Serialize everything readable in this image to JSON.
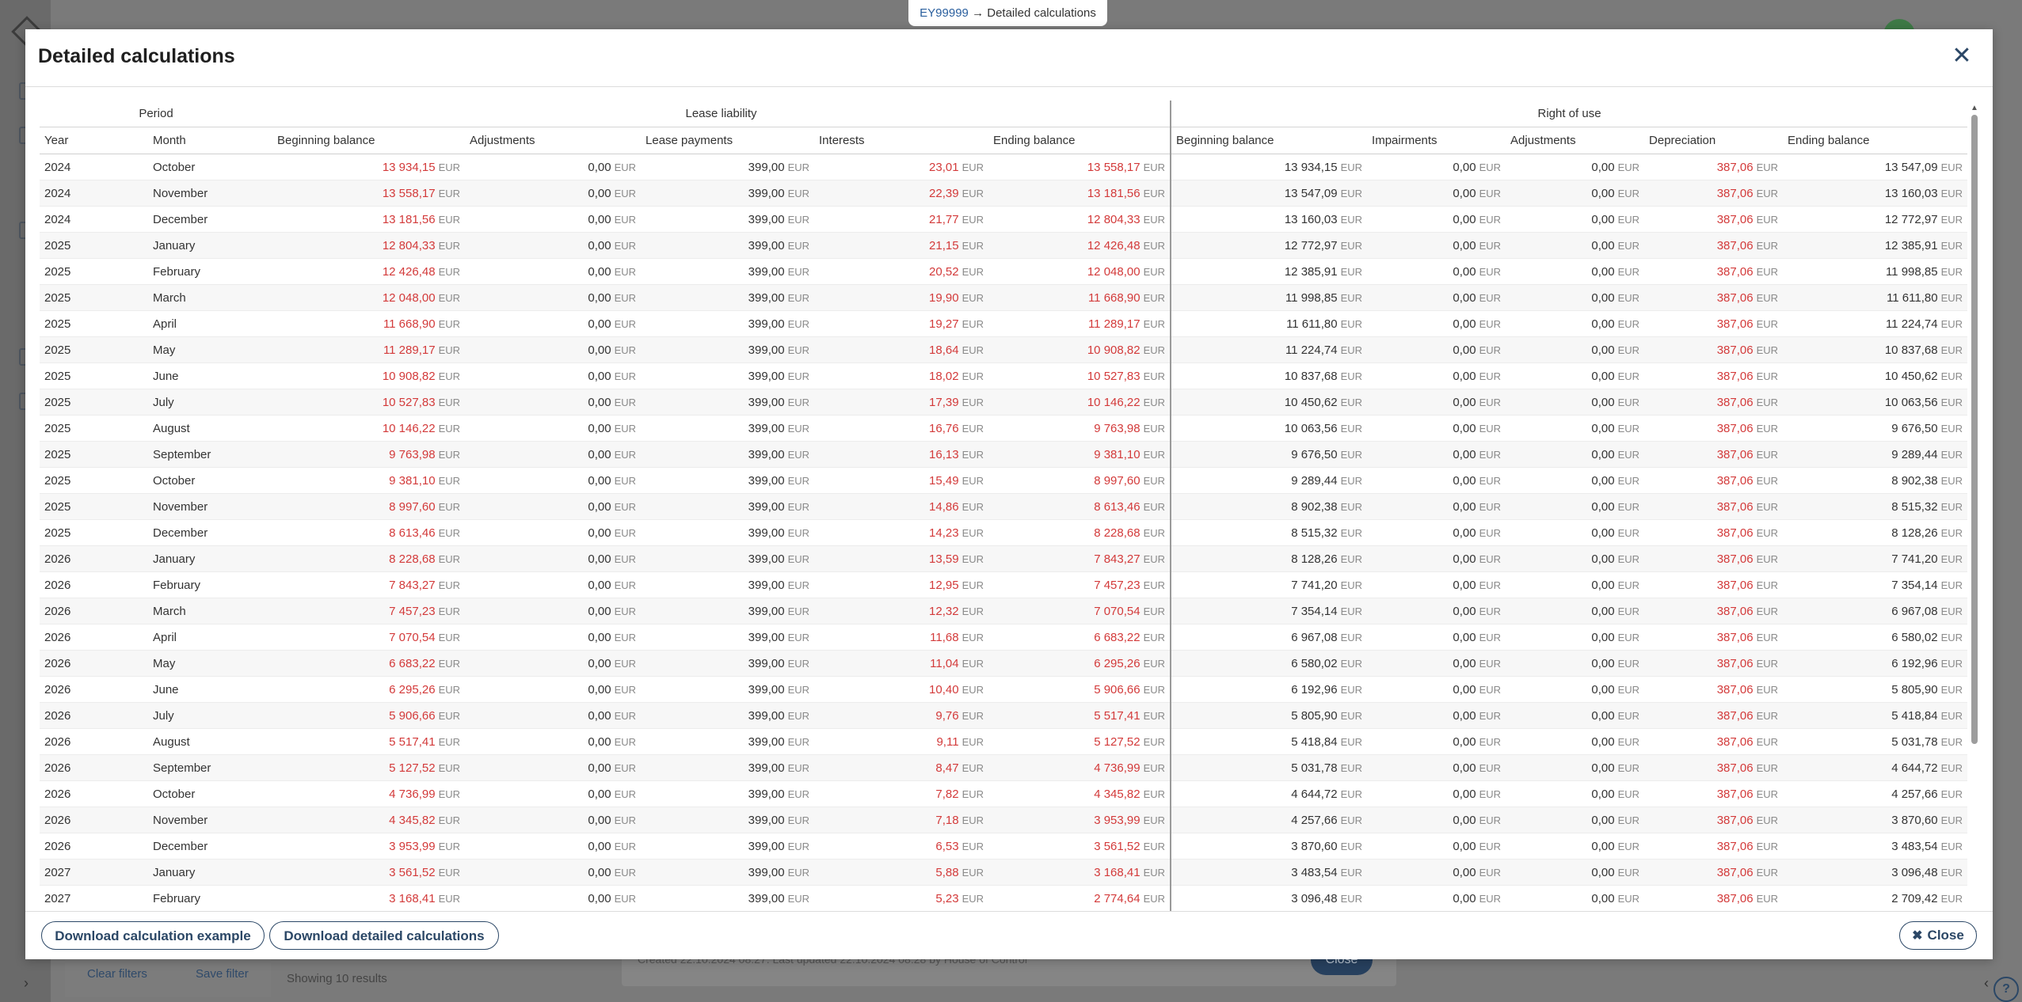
{
  "breadcrumb": {
    "link": "EY99999",
    "separator": "→",
    "current": "Detailed calculations"
  },
  "background": {
    "clear_filters": "Clear filters",
    "save_filter": "Save filter",
    "showing": "Showing 10 results",
    "card_text": "Created 22.10.2024 08:27. Last updated 22.10.2024 08:28 by House of Control",
    "card_close": "Close"
  },
  "modal": {
    "title": "Detailed calculations",
    "close_icon": "close-icon",
    "groups": {
      "period": "Period",
      "lease_liability": "Lease liability",
      "right_of_use": "Right of use"
    },
    "columns": {
      "year": "Year",
      "month": "Month",
      "ll_beginning": "Beginning balance",
      "ll_adjustments": "Adjustments",
      "ll_payments": "Lease payments",
      "ll_interests": "Interests",
      "ll_ending": "Ending balance",
      "ru_beginning": "Beginning balance",
      "ru_impairments": "Impairments",
      "ru_adjustments": "Adjustments",
      "ru_depreciation": "Depreciation",
      "ru_ending": "Ending balance"
    },
    "currency": "EUR",
    "rows": [
      {
        "year": "2024",
        "month": "October",
        "ll_begin": "13 934,15",
        "ll_adj": "0,00",
        "ll_pay": "399,00",
        "ll_int": "23,01",
        "ll_end": "13 558,17",
        "ru_begin": "13 934,15",
        "ru_imp": "0,00",
        "ru_adj": "0,00",
        "ru_dep": "387,06",
        "ru_end": "13 547,09"
      },
      {
        "year": "2024",
        "month": "November",
        "ll_begin": "13 558,17",
        "ll_adj": "0,00",
        "ll_pay": "399,00",
        "ll_int": "22,39",
        "ll_end": "13 181,56",
        "ru_begin": "13 547,09",
        "ru_imp": "0,00",
        "ru_adj": "0,00",
        "ru_dep": "387,06",
        "ru_end": "13 160,03"
      },
      {
        "year": "2024",
        "month": "December",
        "ll_begin": "13 181,56",
        "ll_adj": "0,00",
        "ll_pay": "399,00",
        "ll_int": "21,77",
        "ll_end": "12 804,33",
        "ru_begin": "13 160,03",
        "ru_imp": "0,00",
        "ru_adj": "0,00",
        "ru_dep": "387,06",
        "ru_end": "12 772,97"
      },
      {
        "year": "2025",
        "month": "January",
        "ll_begin": "12 804,33",
        "ll_adj": "0,00",
        "ll_pay": "399,00",
        "ll_int": "21,15",
        "ll_end": "12 426,48",
        "ru_begin": "12 772,97",
        "ru_imp": "0,00",
        "ru_adj": "0,00",
        "ru_dep": "387,06",
        "ru_end": "12 385,91"
      },
      {
        "year": "2025",
        "month": "February",
        "ll_begin": "12 426,48",
        "ll_adj": "0,00",
        "ll_pay": "399,00",
        "ll_int": "20,52",
        "ll_end": "12 048,00",
        "ru_begin": "12 385,91",
        "ru_imp": "0,00",
        "ru_adj": "0,00",
        "ru_dep": "387,06",
        "ru_end": "11 998,85"
      },
      {
        "year": "2025",
        "month": "March",
        "ll_begin": "12 048,00",
        "ll_adj": "0,00",
        "ll_pay": "399,00",
        "ll_int": "19,90",
        "ll_end": "11 668,90",
        "ru_begin": "11 998,85",
        "ru_imp": "0,00",
        "ru_adj": "0,00",
        "ru_dep": "387,06",
        "ru_end": "11 611,80"
      },
      {
        "year": "2025",
        "month": "April",
        "ll_begin": "11 668,90",
        "ll_adj": "0,00",
        "ll_pay": "399,00",
        "ll_int": "19,27",
        "ll_end": "11 289,17",
        "ru_begin": "11 611,80",
        "ru_imp": "0,00",
        "ru_adj": "0,00",
        "ru_dep": "387,06",
        "ru_end": "11 224,74"
      },
      {
        "year": "2025",
        "month": "May",
        "ll_begin": "11 289,17",
        "ll_adj": "0,00",
        "ll_pay": "399,00",
        "ll_int": "18,64",
        "ll_end": "10 908,82",
        "ru_begin": "11 224,74",
        "ru_imp": "0,00",
        "ru_adj": "0,00",
        "ru_dep": "387,06",
        "ru_end": "10 837,68"
      },
      {
        "year": "2025",
        "month": "June",
        "ll_begin": "10 908,82",
        "ll_adj": "0,00",
        "ll_pay": "399,00",
        "ll_int": "18,02",
        "ll_end": "10 527,83",
        "ru_begin": "10 837,68",
        "ru_imp": "0,00",
        "ru_adj": "0,00",
        "ru_dep": "387,06",
        "ru_end": "10 450,62"
      },
      {
        "year": "2025",
        "month": "July",
        "ll_begin": "10 527,83",
        "ll_adj": "0,00",
        "ll_pay": "399,00",
        "ll_int": "17,39",
        "ll_end": "10 146,22",
        "ru_begin": "10 450,62",
        "ru_imp": "0,00",
        "ru_adj": "0,00",
        "ru_dep": "387,06",
        "ru_end": "10 063,56"
      },
      {
        "year": "2025",
        "month": "August",
        "ll_begin": "10 146,22",
        "ll_adj": "0,00",
        "ll_pay": "399,00",
        "ll_int": "16,76",
        "ll_end": "9 763,98",
        "ru_begin": "10 063,56",
        "ru_imp": "0,00",
        "ru_adj": "0,00",
        "ru_dep": "387,06",
        "ru_end": "9 676,50"
      },
      {
        "year": "2025",
        "month": "September",
        "ll_begin": "9 763,98",
        "ll_adj": "0,00",
        "ll_pay": "399,00",
        "ll_int": "16,13",
        "ll_end": "9 381,10",
        "ru_begin": "9 676,50",
        "ru_imp": "0,00",
        "ru_adj": "0,00",
        "ru_dep": "387,06",
        "ru_end": "9 289,44"
      },
      {
        "year": "2025",
        "month": "October",
        "ll_begin": "9 381,10",
        "ll_adj": "0,00",
        "ll_pay": "399,00",
        "ll_int": "15,49",
        "ll_end": "8 997,60",
        "ru_begin": "9 289,44",
        "ru_imp": "0,00",
        "ru_adj": "0,00",
        "ru_dep": "387,06",
        "ru_end": "8 902,38"
      },
      {
        "year": "2025",
        "month": "November",
        "ll_begin": "8 997,60",
        "ll_adj": "0,00",
        "ll_pay": "399,00",
        "ll_int": "14,86",
        "ll_end": "8 613,46",
        "ru_begin": "8 902,38",
        "ru_imp": "0,00",
        "ru_adj": "0,00",
        "ru_dep": "387,06",
        "ru_end": "8 515,32"
      },
      {
        "year": "2025",
        "month": "December",
        "ll_begin": "8 613,46",
        "ll_adj": "0,00",
        "ll_pay": "399,00",
        "ll_int": "14,23",
        "ll_end": "8 228,68",
        "ru_begin": "8 515,32",
        "ru_imp": "0,00",
        "ru_adj": "0,00",
        "ru_dep": "387,06",
        "ru_end": "8 128,26"
      },
      {
        "year": "2026",
        "month": "January",
        "ll_begin": "8 228,68",
        "ll_adj": "0,00",
        "ll_pay": "399,00",
        "ll_int": "13,59",
        "ll_end": "7 843,27",
        "ru_begin": "8 128,26",
        "ru_imp": "0,00",
        "ru_adj": "0,00",
        "ru_dep": "387,06",
        "ru_end": "7 741,20"
      },
      {
        "year": "2026",
        "month": "February",
        "ll_begin": "7 843,27",
        "ll_adj": "0,00",
        "ll_pay": "399,00",
        "ll_int": "12,95",
        "ll_end": "7 457,23",
        "ru_begin": "7 741,20",
        "ru_imp": "0,00",
        "ru_adj": "0,00",
        "ru_dep": "387,06",
        "ru_end": "7 354,14"
      },
      {
        "year": "2026",
        "month": "March",
        "ll_begin": "7 457,23",
        "ll_adj": "0,00",
        "ll_pay": "399,00",
        "ll_int": "12,32",
        "ll_end": "7 070,54",
        "ru_begin": "7 354,14",
        "ru_imp": "0,00",
        "ru_adj": "0,00",
        "ru_dep": "387,06",
        "ru_end": "6 967,08"
      },
      {
        "year": "2026",
        "month": "April",
        "ll_begin": "7 070,54",
        "ll_adj": "0,00",
        "ll_pay": "399,00",
        "ll_int": "11,68",
        "ll_end": "6 683,22",
        "ru_begin": "6 967,08",
        "ru_imp": "0,00",
        "ru_adj": "0,00",
        "ru_dep": "387,06",
        "ru_end": "6 580,02"
      },
      {
        "year": "2026",
        "month": "May",
        "ll_begin": "6 683,22",
        "ll_adj": "0,00",
        "ll_pay": "399,00",
        "ll_int": "11,04",
        "ll_end": "6 295,26",
        "ru_begin": "6 580,02",
        "ru_imp": "0,00",
        "ru_adj": "0,00",
        "ru_dep": "387,06",
        "ru_end": "6 192,96"
      },
      {
        "year": "2026",
        "month": "June",
        "ll_begin": "6 295,26",
        "ll_adj": "0,00",
        "ll_pay": "399,00",
        "ll_int": "10,40",
        "ll_end": "5 906,66",
        "ru_begin": "6 192,96",
        "ru_imp": "0,00",
        "ru_adj": "0,00",
        "ru_dep": "387,06",
        "ru_end": "5 805,90"
      },
      {
        "year": "2026",
        "month": "July",
        "ll_begin": "5 906,66",
        "ll_adj": "0,00",
        "ll_pay": "399,00",
        "ll_int": "9,76",
        "ll_end": "5 517,41",
        "ru_begin": "5 805,90",
        "ru_imp": "0,00",
        "ru_adj": "0,00",
        "ru_dep": "387,06",
        "ru_end": "5 418,84"
      },
      {
        "year": "2026",
        "month": "August",
        "ll_begin": "5 517,41",
        "ll_adj": "0,00",
        "ll_pay": "399,00",
        "ll_int": "9,11",
        "ll_end": "5 127,52",
        "ru_begin": "5 418,84",
        "ru_imp": "0,00",
        "ru_adj": "0,00",
        "ru_dep": "387,06",
        "ru_end": "5 031,78"
      },
      {
        "year": "2026",
        "month": "September",
        "ll_begin": "5 127,52",
        "ll_adj": "0,00",
        "ll_pay": "399,00",
        "ll_int": "8,47",
        "ll_end": "4 736,99",
        "ru_begin": "5 031,78",
        "ru_imp": "0,00",
        "ru_adj": "0,00",
        "ru_dep": "387,06",
        "ru_end": "4 644,72"
      },
      {
        "year": "2026",
        "month": "October",
        "ll_begin": "4 736,99",
        "ll_adj": "0,00",
        "ll_pay": "399,00",
        "ll_int": "7,82",
        "ll_end": "4 345,82",
        "ru_begin": "4 644,72",
        "ru_imp": "0,00",
        "ru_adj": "0,00",
        "ru_dep": "387,06",
        "ru_end": "4 257,66"
      },
      {
        "year": "2026",
        "month": "November",
        "ll_begin": "4 345,82",
        "ll_adj": "0,00",
        "ll_pay": "399,00",
        "ll_int": "7,18",
        "ll_end": "3 953,99",
        "ru_begin": "4 257,66",
        "ru_imp": "0,00",
        "ru_adj": "0,00",
        "ru_dep": "387,06",
        "ru_end": "3 870,60"
      },
      {
        "year": "2026",
        "month": "December",
        "ll_begin": "3 953,99",
        "ll_adj": "0,00",
        "ll_pay": "399,00",
        "ll_int": "6,53",
        "ll_end": "3 561,52",
        "ru_begin": "3 870,60",
        "ru_imp": "0,00",
        "ru_adj": "0,00",
        "ru_dep": "387,06",
        "ru_end": "3 483,54"
      },
      {
        "year": "2027",
        "month": "January",
        "ll_begin": "3 561,52",
        "ll_adj": "0,00",
        "ll_pay": "399,00",
        "ll_int": "5,88",
        "ll_end": "3 168,41",
        "ru_begin": "3 483,54",
        "ru_imp": "0,00",
        "ru_adj": "0,00",
        "ru_dep": "387,06",
        "ru_end": "3 096,48"
      },
      {
        "year": "2027",
        "month": "February",
        "ll_begin": "3 168,41",
        "ll_adj": "0,00",
        "ll_pay": "399,00",
        "ll_int": "5,23",
        "ll_end": "2 774,64",
        "ru_begin": "3 096,48",
        "ru_imp": "0,00",
        "ru_adj": "0,00",
        "ru_dep": "387,06",
        "ru_end": "2 709,42"
      }
    ]
  },
  "footer": {
    "download_example": "Download calculation example",
    "download_detailed": "Download detailed calculations",
    "close": "Close"
  },
  "colors": {
    "accent": "#2b4766",
    "negative_value": "#d33a3a",
    "link": "#2a5f9e"
  }
}
